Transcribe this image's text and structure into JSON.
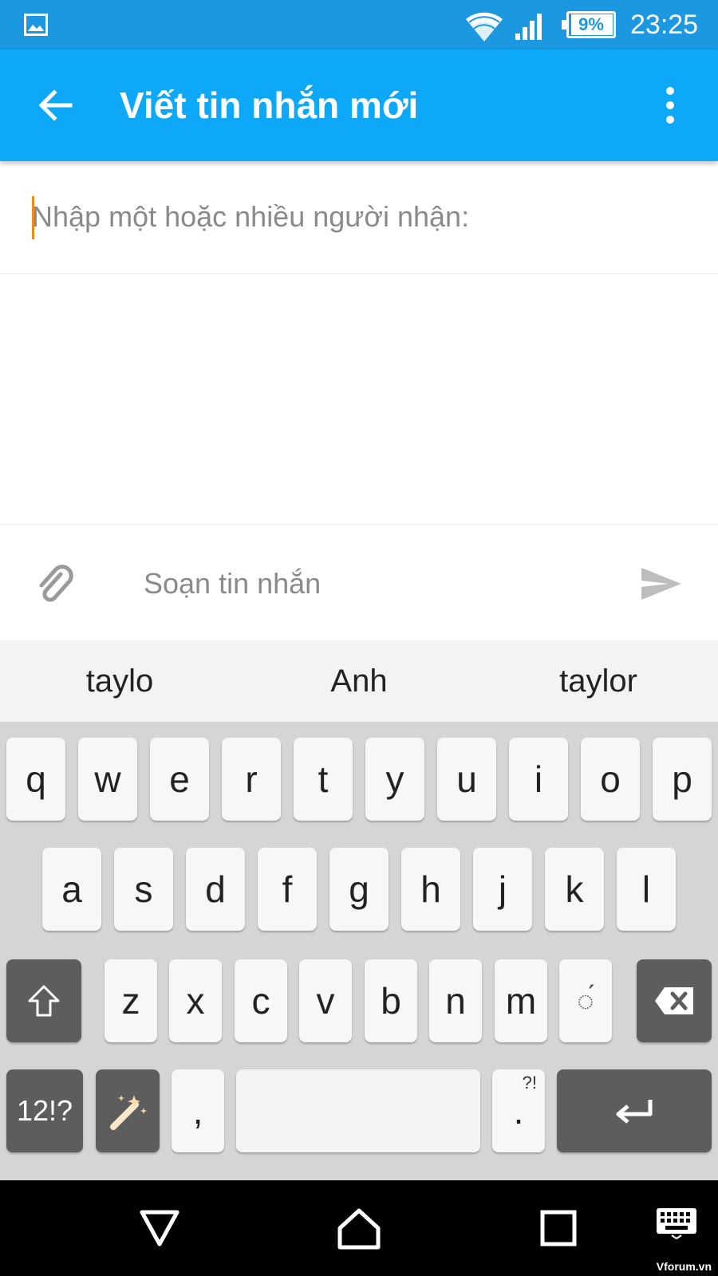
{
  "status_bar": {
    "time": "23:25",
    "battery_percent": "9%",
    "icons": [
      "gallery-icon",
      "wifi-icon",
      "signal-icon",
      "battery-icon"
    ]
  },
  "app_bar": {
    "title": "Viết tin nhắn mới",
    "back_icon": "arrow-left-icon",
    "menu_icon": "more-vertical-icon"
  },
  "recipient": {
    "placeholder": "Nhập một hoặc nhiều người nhận:",
    "value": ""
  },
  "compose": {
    "placeholder": "Soạn tin nhắn",
    "value": "",
    "attach_icon": "paperclip-icon",
    "send_icon": "send-icon"
  },
  "suggestions": [
    "taylo",
    "Anh",
    "taylor"
  ],
  "keyboard": {
    "row1": [
      "q",
      "w",
      "e",
      "r",
      "t",
      "y",
      "u",
      "i",
      "o",
      "p"
    ],
    "row2": [
      "a",
      "s",
      "d",
      "f",
      "g",
      "h",
      "j",
      "k",
      "l"
    ],
    "row3": [
      "z",
      "x",
      "c",
      "v",
      "b",
      "n",
      "m",
      "◌́"
    ],
    "symbols_label": "12!?",
    "comma_label": ",",
    "period_label": ".",
    "period_sub": "?!"
  },
  "watermark": "Vforum.vn",
  "colors": {
    "status_bar": "#1b98e0",
    "app_bar": "#0ea8f8",
    "caret": "#f08a1c",
    "dark_key": "#5d5d5d"
  }
}
